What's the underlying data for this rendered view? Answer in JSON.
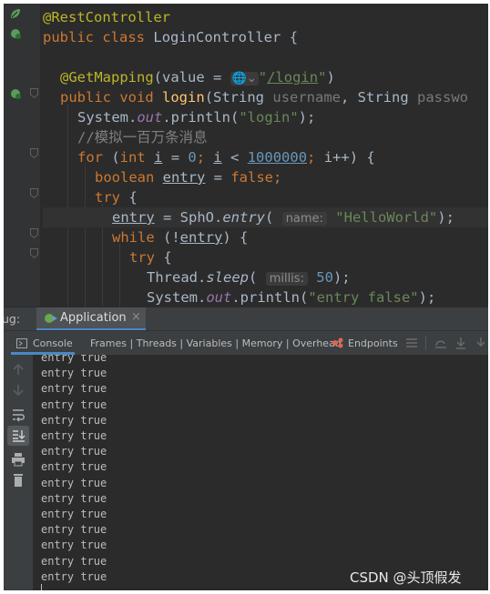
{
  "editor": {
    "lines": [
      {
        "annotation": "@RestController"
      },
      {
        "kw1": "public",
        "kw2": "class",
        "name": "LoginController",
        "brace": "{"
      },
      {},
      {
        "annotation": "@GetMapping",
        "open": "(value = ",
        "path_prefix": "\"",
        "path": "/login",
        "path_suffix": "\"",
        "close": ")"
      },
      {
        "kw1": "public",
        "kw2": "void",
        "method": "login",
        "params_a": "(String",
        "param1": "username",
        "params_b": ", String",
        "param2": "passwo"
      },
      {
        "prefix": "System.",
        "field": "out",
        "call": ".println(",
        "arg": "\"login\"",
        "end": ");"
      },
      {
        "comment": "//模拟一百万条消息"
      },
      {
        "kw": "for",
        "p1": " (",
        "kw2": "int",
        "var": "i",
        "eq": " = ",
        "zero": "0",
        "semi": "; ",
        "var2": "i",
        "lt": " < ",
        "limit": "1000000",
        "semi2": "; ",
        "inc": "i++) {"
      },
      {
        "kw": "boolean",
        "var": "entry",
        "eq": " = ",
        "val": "false",
        "end": ";"
      },
      {
        "kw": "try",
        "brace": " {"
      },
      {
        "var": "entry",
        "eq": " = SphO.",
        "call": "entry",
        "paren": "(",
        "hint": "name:",
        "arg": "\"HelloWorld\"",
        "end": ");"
      },
      {
        "kw": "while",
        "open": " (!",
        "var": "entry",
        "end": ") {"
      },
      {
        "kw": "try",
        "brace": " {"
      },
      {
        "prefix": "Thread.",
        "call": "sleep",
        "paren": "(",
        "hint": "millis:",
        "arg": "50",
        "end": ");"
      },
      {
        "prefix": "System.",
        "field": "out",
        "call": ".println(",
        "arg": "\"entry false\"",
        "end": ");"
      }
    ]
  },
  "debug": {
    "prefix": "ug:",
    "tab": "Application",
    "close": "×"
  },
  "toolbar": {
    "console_tab": "Console",
    "frames": "Frames",
    "threads": "Threads",
    "variables": "Variables",
    "memory": "Memory",
    "overhead": "Overhead",
    "endpoints": "Endpoints",
    "separator": " | "
  },
  "console": {
    "lines": [
      "entry true",
      "entry true",
      "entry true",
      "entry true",
      "entry true",
      "entry true",
      "entry true",
      "entry true",
      "entry true",
      "entry true",
      "entry true",
      "entry true",
      "entry true",
      "entry true",
      "entry true"
    ]
  },
  "watermark": "CSDN @头顶假发",
  "colors": {
    "background": "#2b2b2b",
    "keyword": "#cc7832",
    "string": "#6a8759",
    "number": "#6897bb",
    "method": "#ffc66d",
    "annotation": "#bbb529",
    "field": "#9876aa"
  }
}
